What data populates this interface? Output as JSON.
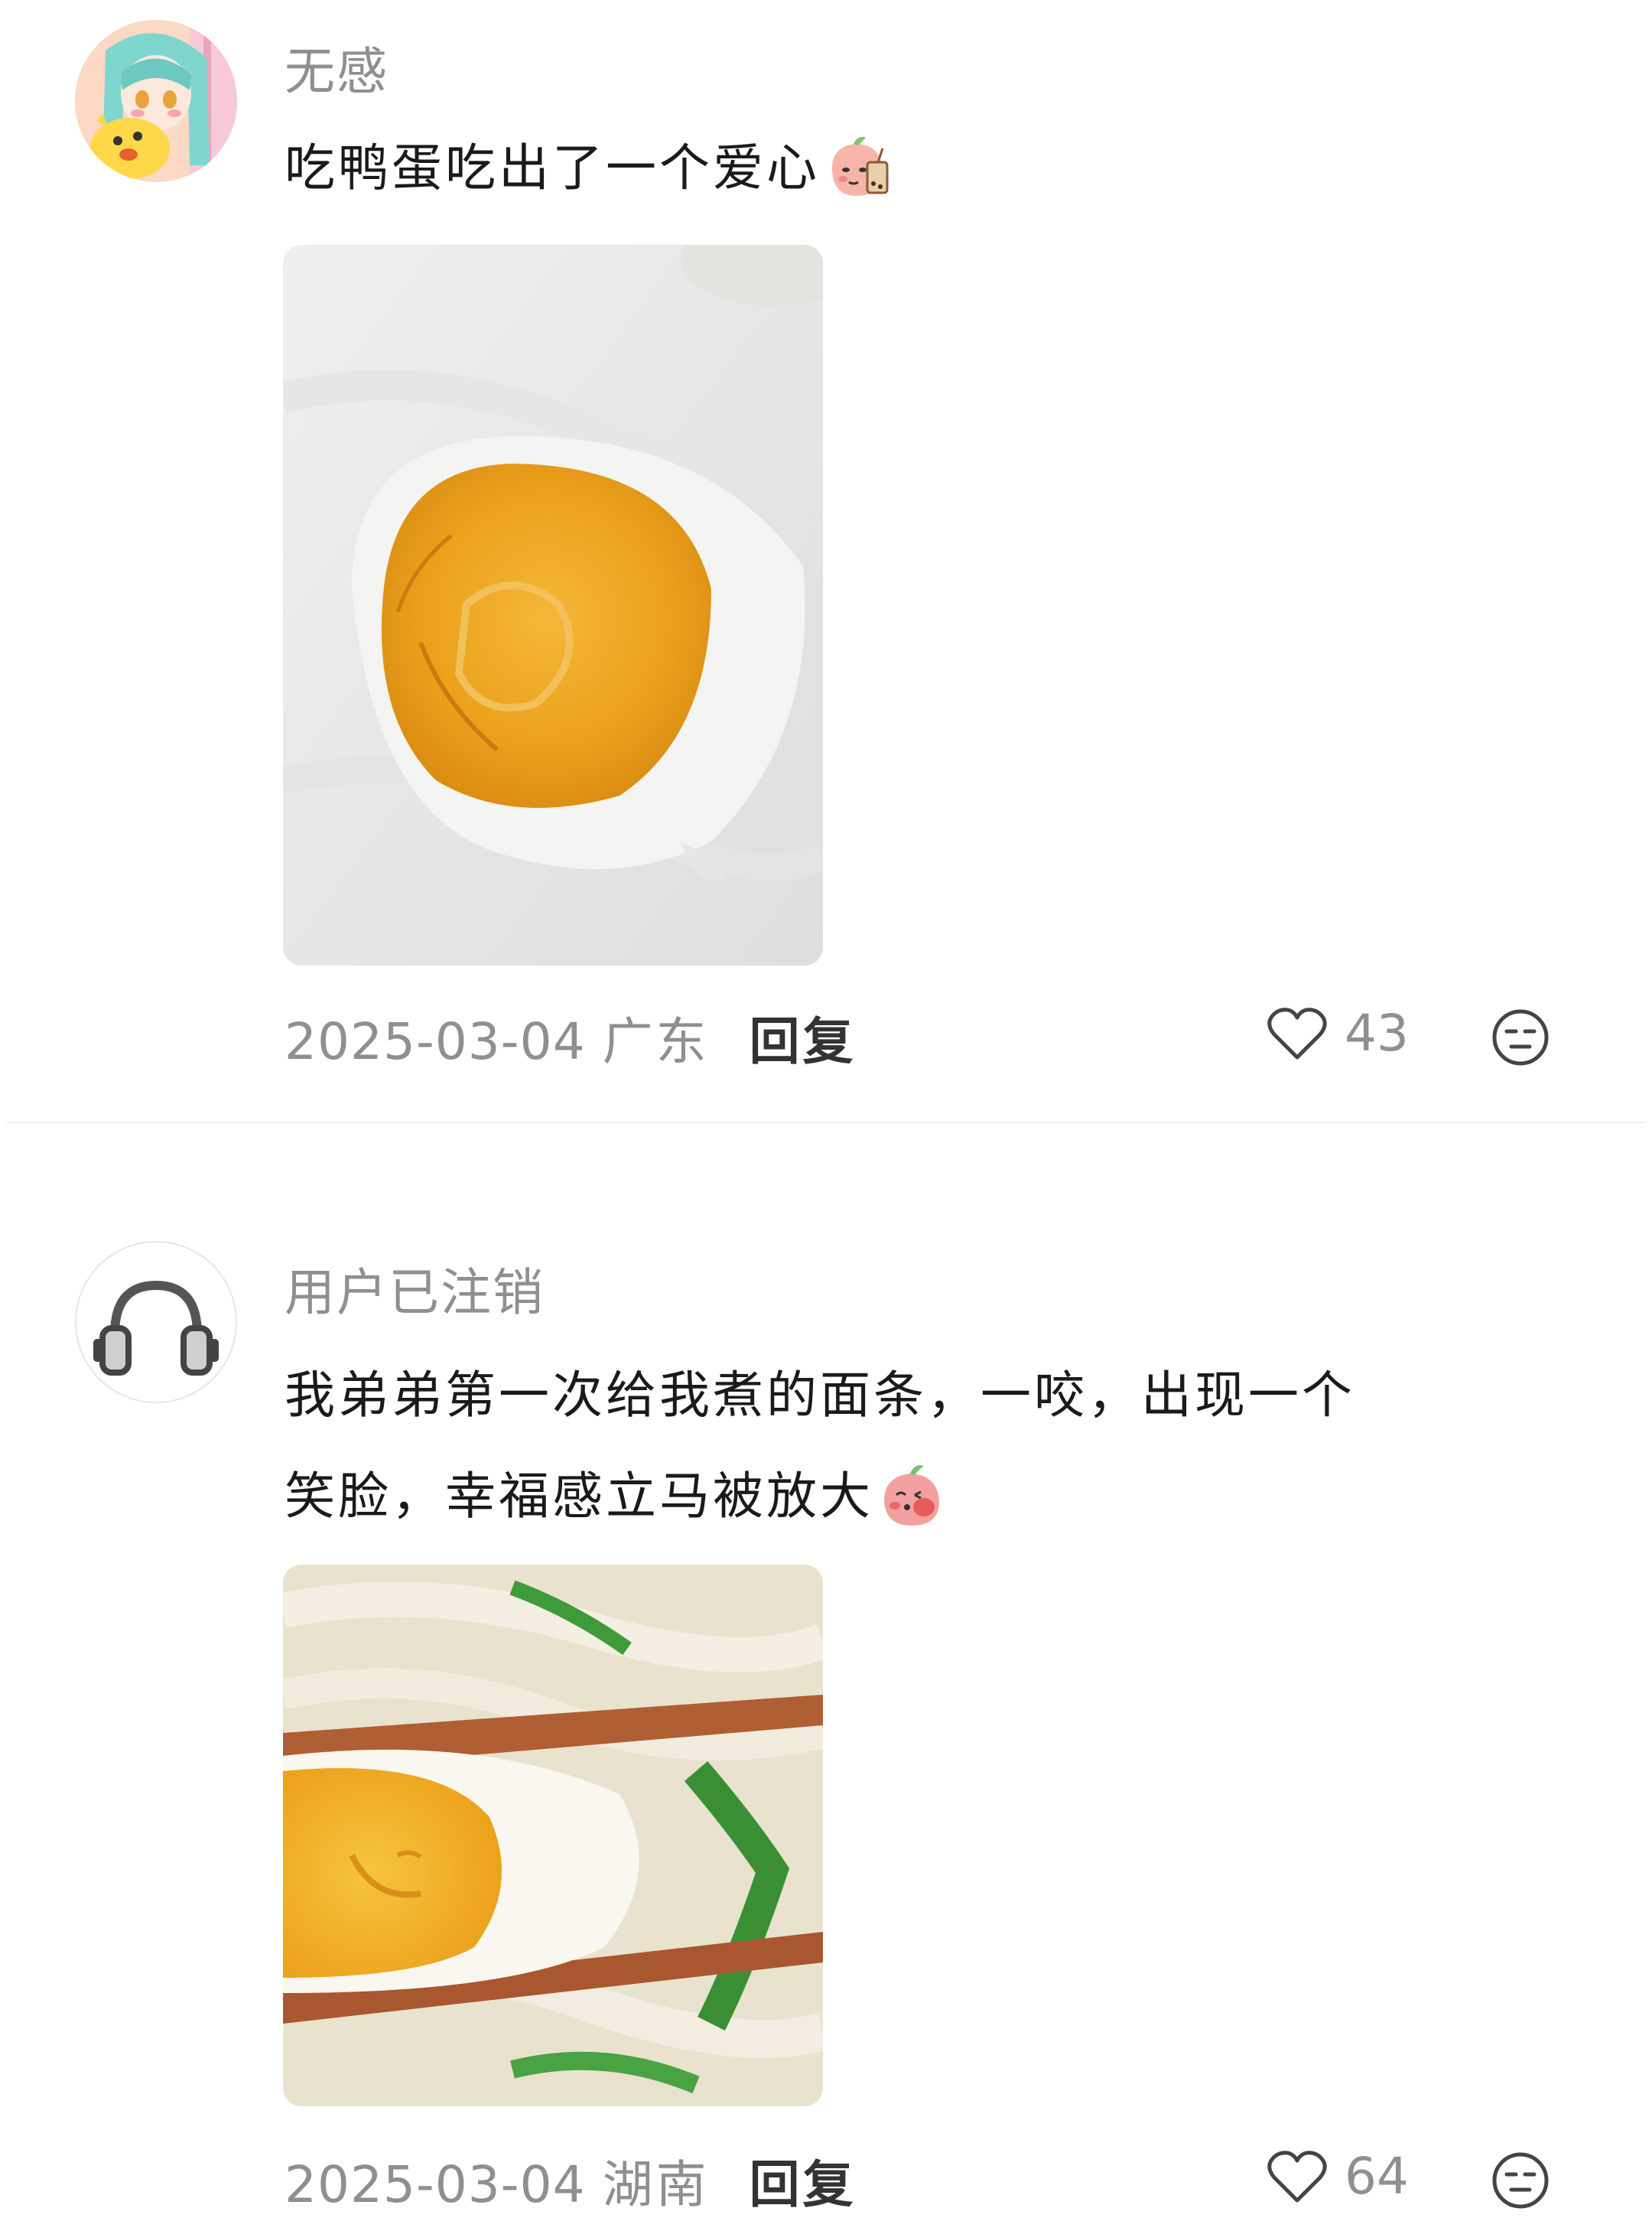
{
  "comments": [
    {
      "username": "无感",
      "text": "吃鸭蛋吃出了一个爱心",
      "emoji_icon": "peach-bubble-tea-emoji",
      "photo": "salted-duck-egg-with-heart-shaped-yolk",
      "date": "2025-03-04",
      "region": "广东",
      "reply_label": "回复",
      "likes": "43"
    },
    {
      "username": "用户已注销",
      "text_line1": "我弟弟第一次给我煮的面条，一咬，出现一个",
      "text_line2": "笑脸，幸福感立马被放大",
      "emoji_icon": "peach-blushing-emoji",
      "photo": "egg-with-smiley-face-on-chopsticks-over-noodles",
      "date": "2025-03-04",
      "region": "湖南",
      "reply_label": "回复",
      "likes": "64"
    }
  ],
  "colors": {
    "username": "#8f8f8f",
    "body_text": "#1a1a1a",
    "meta_text": "#8f8f8f",
    "reply": "#333333",
    "divider": "#eeeeee"
  }
}
